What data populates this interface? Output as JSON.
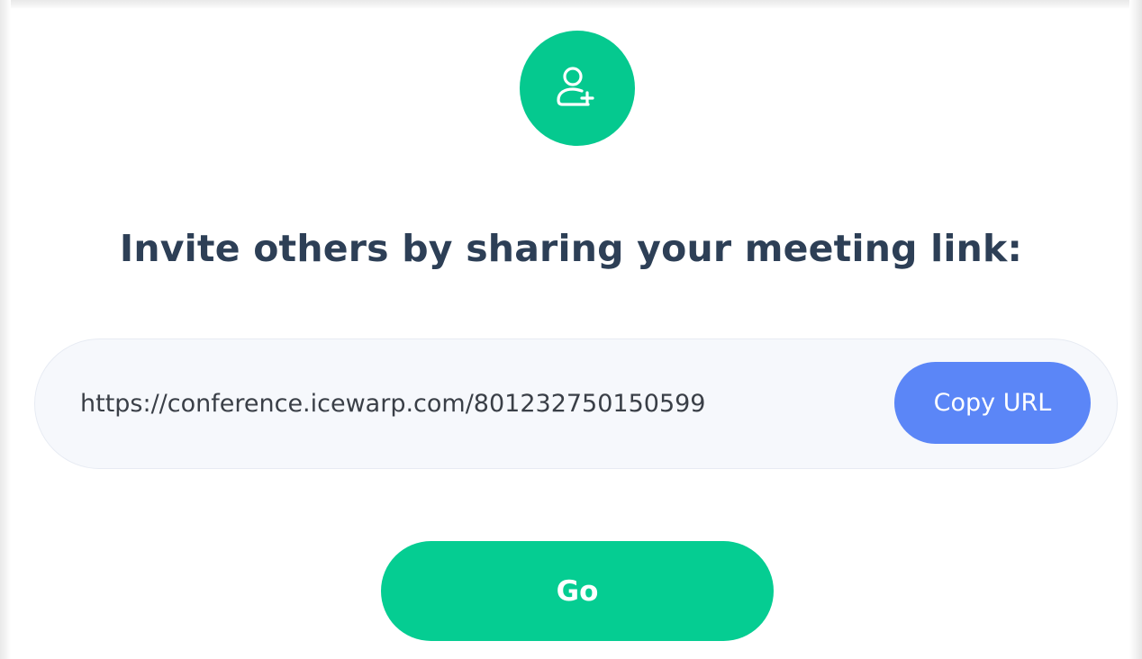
{
  "invite": {
    "icon": "add-user-icon",
    "title": "Invite others by sharing your meeting link:",
    "meeting_url": "https://conference.icewarp.com/801232750150599",
    "copy_label": "Copy URL",
    "go_label": "Go"
  },
  "colors": {
    "accent_green": "#05c98f",
    "copy_blue": "#5b86f7",
    "title_text": "#2d3f56",
    "link_box_bg": "#f6f8fc"
  }
}
